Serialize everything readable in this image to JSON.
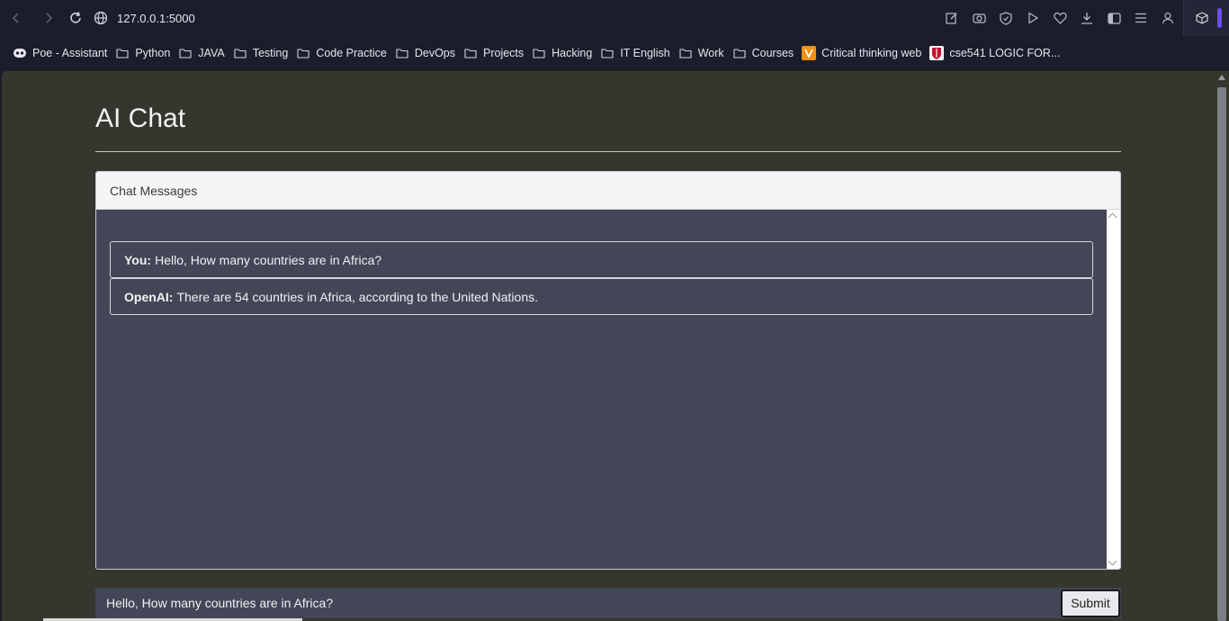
{
  "browser": {
    "url": "127.0.0.1:5000",
    "icons": [
      "back-icon",
      "forward-icon",
      "reload-icon",
      "site-info-icon",
      "edit-icon",
      "camera-icon",
      "shield-icon",
      "play-icon",
      "heart-icon",
      "download-icon",
      "sidebar-icon",
      "menu-icon",
      "profile-icon",
      "extensions-icon"
    ],
    "accent": "#6b4cff"
  },
  "bookmarks": [
    {
      "label": "Poe - Assistant",
      "icon": "poe-icon"
    },
    {
      "label": "Python",
      "icon": "folder-icon"
    },
    {
      "label": "JAVA",
      "icon": "folder-icon"
    },
    {
      "label": "Testing",
      "icon": "folder-icon"
    },
    {
      "label": "Code Practice",
      "icon": "folder-icon"
    },
    {
      "label": "DevOps",
      "icon": "folder-icon"
    },
    {
      "label": "Projects",
      "icon": "folder-icon"
    },
    {
      "label": "Hacking",
      "icon": "folder-icon"
    },
    {
      "label": "IT English",
      "icon": "folder-icon"
    },
    {
      "label": "Work",
      "icon": "folder-icon"
    },
    {
      "label": "Courses",
      "icon": "folder-icon"
    },
    {
      "label": "Critical thinking web",
      "icon": "critical-thinking-icon"
    },
    {
      "label": "cse541 LOGIC FOR...",
      "icon": "cse541-icon"
    }
  ],
  "page": {
    "title": "AI Chat",
    "panel_title": "Chat Messages",
    "messages": [
      {
        "sender": "You:",
        "text": "Hello, How many countries are in Africa?"
      },
      {
        "sender": "OpenAI:",
        "text": "There are 54 countries in Africa, according to the United Nations."
      }
    ],
    "input_value": "Hello, How many countries are in Africa?",
    "submit_label": "Submit"
  },
  "colors": {
    "page_bg": "#35372e",
    "chat_bg": "#434656",
    "browser_bg": "#1b1d2b"
  }
}
